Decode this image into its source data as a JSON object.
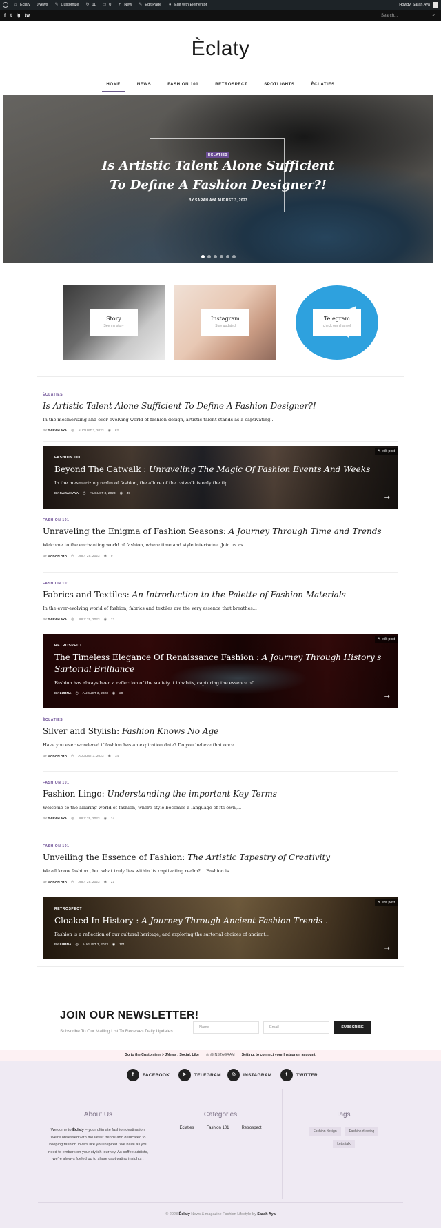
{
  "admin_bar": {
    "site": "Èclaty",
    "jnews": "JNews",
    "customize": "Customize",
    "updates": "11",
    "comments": "0",
    "new": "New",
    "edit_page": "Edit Page",
    "elementor": "Edit with Elementor",
    "howdy": "Howdy, Sarah Aya"
  },
  "topbar": {
    "social": [
      "f",
      "t",
      "ig",
      "tw"
    ],
    "search_placeholder": "Search..."
  },
  "site": {
    "logo": "Èclaty"
  },
  "nav": [
    "HOME",
    "NEWS",
    "FASHION 101",
    "RETROSPECT",
    "SPOTLIGHTS",
    "ÈCLATIES"
  ],
  "hero": {
    "category": "ÈCLATIES",
    "title": "Is Artistic Talent Alone Sufficient To Define A Fashion Designer?!",
    "meta": "BY SARAH AYA   AUGUST 3, 2023",
    "slides": 6,
    "active_slide": 1
  },
  "promos": [
    {
      "title": "Story",
      "sub": "See my story"
    },
    {
      "title": "Instagram",
      "sub": "Stay updated"
    },
    {
      "title": "Telegram",
      "sub": "check our channel"
    }
  ],
  "posts": [
    {
      "cat": "ÈCLATIES",
      "title_a": "",
      "title_b": "Is Artistic Talent Alone Sufficient To Define A Fashion Designer?!",
      "excerpt": "In the mesmerizing and ever-evolving world of fashion design, artistic talent stands as a captivating...",
      "author": "SARAH AYA",
      "date": "AUGUST 3, 2023",
      "views": "62"
    },
    {
      "cat": "FASHION 101",
      "title_a": "Beyond The Catwalk : ",
      "title_b": "Unraveling The Magic Of Fashion Events And Weeks",
      "excerpt": "In the mesmerizing realm of fashion, the allure of the catwalk is only the tip...",
      "author": "SARAH AYA",
      "date": "AUGUST 3, 2023",
      "views": "49",
      "edit": "edit post"
    },
    {
      "cat": "FASHION 101",
      "title_a": "Unraveling the Enigma of Fashion Seasons: ",
      "title_b": "A Journey Through Time and Trends",
      "excerpt": "Welcome to the enchanting world of fashion, where time and style intertwine. Join us as...",
      "author": "SARAH AYA",
      "date": "JULY 29, 2023",
      "views": "9"
    },
    {
      "cat": "FASHION 101",
      "title_a": "Fabrics and Textiles: ",
      "title_b": "An Introduction to the Palette of Fashion Materials",
      "excerpt": "In the ever-evolving world of fashion, fabrics and textiles are the very essence that breathes...",
      "author": "SARAH AYA",
      "date": "JULY 29, 2023",
      "views": "13"
    },
    {
      "cat": "RETROSPECT",
      "title_a": "The Timeless Elegance Of Renaissance Fashion : ",
      "title_b": "A Journey Through History's Sartorial Brilliance",
      "excerpt": "Fashion has always been a reflection of the society it inhabits, capturing the essence of...",
      "author": "LUBNA",
      "date": "AUGUST 3, 2023",
      "views": "20",
      "edit": "edit post"
    },
    {
      "cat": "ÈCLATIES",
      "title_a": "Silver and Stylish: ",
      "title_b": "Fashion Knows No Age",
      "excerpt": "Have you ever wondered if fashion has an expiration date? Do you believe that once...",
      "author": "SARAH AYA",
      "date": "AUGUST 3, 2023",
      "views": "14"
    },
    {
      "cat": "FASHION 101",
      "title_a": "Fashion Lingo: ",
      "title_b": "Understanding the important Key Terms",
      "excerpt": "Welcome to the alluring world of fashion, where style becomes a language of its own,...",
      "author": "SARAH AYA",
      "date": "JULY 29, 2023",
      "views": "14"
    },
    {
      "cat": "FASHION 101",
      "title_a": "Unveiling the Essence of Fashion: ",
      "title_b": "The Artistic Tapestry of Creativity",
      "excerpt": "We all know fashion , but what truly lies within its captivating realm?... Fashion is...",
      "author": "SARAH AYA",
      "date": "JULY 29, 2023",
      "views": "21"
    },
    {
      "cat": "RETROSPECT",
      "title_a": "Cloaked In History : ",
      "title_b": "A Journey Through Ancient Fashion Trends .",
      "excerpt": "Fashion is a reflection of our cultural heritage, and exploring the sartorial choices of ancient...",
      "author": "LUBNA",
      "date": "AUGUST 3, 2023",
      "views": "101",
      "edit": "edit post"
    }
  ],
  "newsletter": {
    "title": "JOIN OUR NEWSLETTER!",
    "subtitle": "Subscribe To Our Mailing List To Receives Daily Updates",
    "name_placeholder": "Name",
    "email_placeholder": "Email",
    "button": "SUBSCRIBE"
  },
  "instagram_note": {
    "left": "Go to the Customizer > JNews : Social, Like",
    "handle": "@INSTAGRAM",
    "right": "Setting, to connect your Instagram account."
  },
  "footer": {
    "social": [
      "FACEBOOK",
      "TELEGRAM",
      "INSTAGRAM",
      "TWITTER"
    ],
    "about_title": "About Us",
    "about_text_a": "Welcome to ",
    "about_brand": "Èclaty",
    "about_text_b": " – your ultimate fashion destination! We're obsessed with the latest trends and dedicated to keeping fashion lovers like you inspired. We have all you need to embark on your stylish journey. As coffee addicts, we're always fueled up to share captivating insights .",
    "categories_title": "Categories",
    "categories": [
      "Èclaties",
      "Fashion 101",
      "Retrospect"
    ],
    "tags_title": "Tags",
    "tags": [
      "Fashion design",
      "Fashion drawing",
      "Let's talk"
    ],
    "copyright_a": "© 2023 ",
    "copyright_brand": "Èclaty",
    "copyright_b": " News & magazine Fashion Lifestyle by ",
    "copyright_author": "Sarah Aya"
  }
}
